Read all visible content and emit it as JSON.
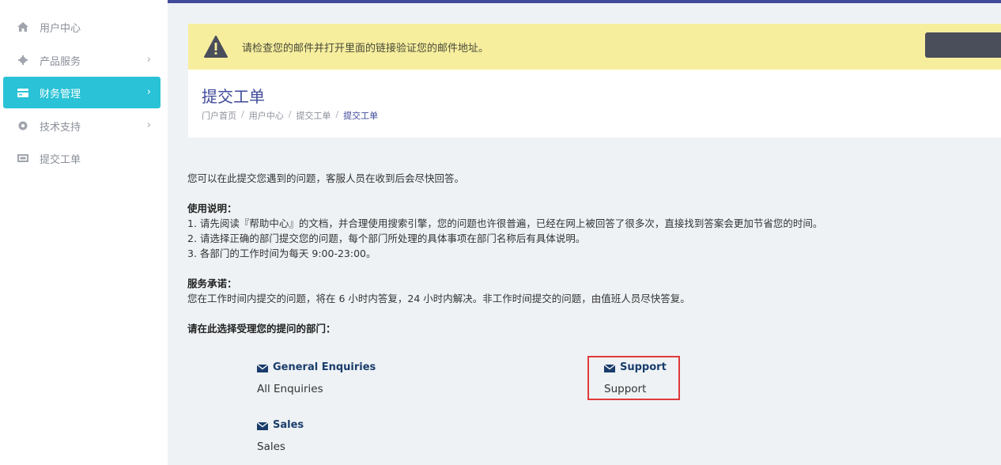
{
  "sidebar": {
    "items": [
      {
        "label": "用户中心",
        "icon": "home-icon",
        "has_chevron": false,
        "active": false
      },
      {
        "label": "产品服务",
        "icon": "gear-icon",
        "has_chevron": true,
        "active": false
      },
      {
        "label": "财务管理",
        "icon": "card-icon",
        "has_chevron": true,
        "active": true
      },
      {
        "label": "技术支持",
        "icon": "lifebuoy-icon",
        "has_chevron": true,
        "active": false
      },
      {
        "label": "提交工单",
        "icon": "ticket-icon",
        "has_chevron": false,
        "active": false
      }
    ]
  },
  "alert": {
    "text": "请检查您的邮件并打开里面的链接验证您的邮件地址。"
  },
  "header": {
    "title": "提交工单",
    "breadcrumb": [
      "门户首页",
      "用户中心",
      "提交工单",
      "提交工单"
    ]
  },
  "content": {
    "intro": "您可以在此提交您遇到的问题，客服人员在收到后会尽快回答。",
    "usage_title": "使用说明：",
    "usage_1": "1. 请先阅读『帮助中心』的文档，并合理使用搜索引擎，您的问题也许很普遍，已经在网上被回答了很多次，直接找到答案会更加节省您的时间。",
    "usage_2": "2. 请选择正确的部门提交您的问题，每个部门所处理的具体事项在部门名称后有具体说明。",
    "usage_3": "3. 各部门的工作时间为每天 9:00-23:00。",
    "promise_title": "服务承诺：",
    "promise_text": "您在工作时间内提交的问题，将在 6 小时内答复，24 小时内解决。非工作时间提交的问题，由值班人员尽快答复。",
    "choose_title": "请在此选择受理您的提问的部门："
  },
  "departments": [
    {
      "name": "General Enquiries",
      "desc": "All Enquiries"
    },
    {
      "name": "Support",
      "desc": "Support"
    },
    {
      "name": "Sales",
      "desc": "Sales"
    }
  ],
  "colors": {
    "accent": "#29c2d6",
    "brand": "#3f4a9a",
    "alert_bg": "#f6ee9d",
    "highlight": "#e03a3a"
  }
}
